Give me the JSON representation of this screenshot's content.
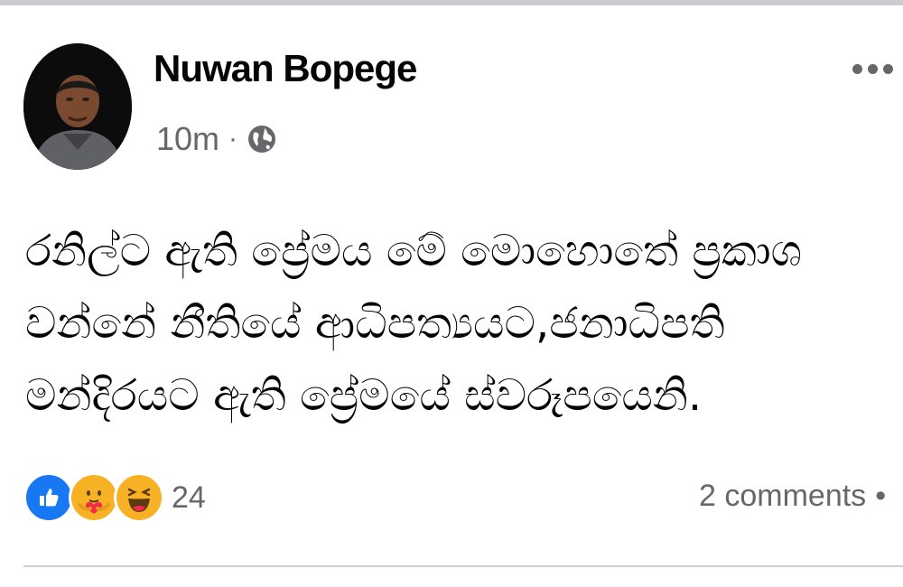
{
  "post": {
    "author": "Nuwan Bopege",
    "time": "10m",
    "separator": "·",
    "privacy_icon": "globe-icon",
    "more_icon": "more-options-icon",
    "text_lines": [
      "රනිල්ට ඇති ප්‍රේමය මේ මොහොතේ ප්‍රකාශ",
      "වන්නේ නීතියේ ආධිපත්‍යයට,ජනාධිපති",
      "මන්දිරයට ඇති ප්‍රේමයේ ස්වරූපයෙනි."
    ]
  },
  "footer": {
    "reaction_icons": [
      "like-icon",
      "care-icon",
      "haha-icon"
    ],
    "reaction_count": "24",
    "comments": "2 comments",
    "bullet": "•"
  },
  "colors": {
    "text": "#050505",
    "secondary": "#65676b",
    "like_blue": "#1877f2",
    "emoji_yellow": "#f7b125",
    "divider": "#ced0d4"
  }
}
